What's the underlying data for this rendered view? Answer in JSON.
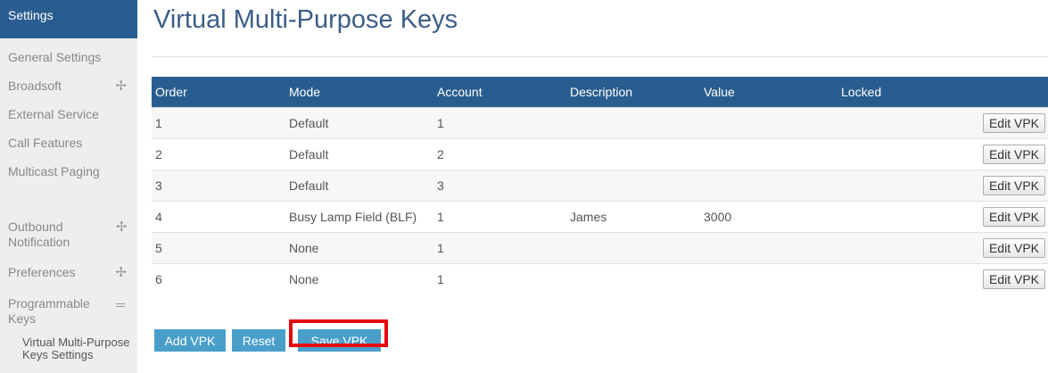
{
  "sidebar": {
    "header": "Settings",
    "items": [
      {
        "label": "General Settings"
      },
      {
        "label": "Broadsoft",
        "expander": "plus"
      },
      {
        "label": "External Service"
      },
      {
        "label": "Call Features"
      },
      {
        "label": "Multicast Paging"
      },
      {
        "label": "Outbound Notification",
        "expander": "plus"
      },
      {
        "label": "Preferences",
        "expander": "plus"
      },
      {
        "label": "Programmable Keys",
        "expander": "minus"
      }
    ],
    "subitem": "Virtual Multi-Purpose Keys Settings"
  },
  "main": {
    "title": "Virtual Multi-Purpose Keys",
    "columns": [
      "Order",
      "Mode",
      "Account",
      "Description",
      "Value",
      "Locked"
    ],
    "rows": [
      {
        "order": "1",
        "mode": "Default",
        "account": "1",
        "description": "",
        "value": "",
        "locked": "",
        "action": "Edit VPK"
      },
      {
        "order": "2",
        "mode": "Default",
        "account": "2",
        "description": "",
        "value": "",
        "locked": "",
        "action": "Edit VPK"
      },
      {
        "order": "3",
        "mode": "Default",
        "account": "3",
        "description": "",
        "value": "",
        "locked": "",
        "action": "Edit VPK"
      },
      {
        "order": "4",
        "mode": "Busy Lamp Field (BLF)",
        "account": "1",
        "description": "James",
        "value": "3000",
        "locked": "",
        "action": "Edit VPK"
      },
      {
        "order": "5",
        "mode": "None",
        "account": "1",
        "description": "",
        "value": "",
        "locked": "",
        "action": "Edit VPK"
      },
      {
        "order": "6",
        "mode": "None",
        "account": "1",
        "description": "",
        "value": "",
        "locked": "",
        "action": "Edit VPK"
      }
    ],
    "buttons": {
      "add": "Add VPK",
      "reset": "Reset",
      "save": "Save VPK"
    }
  },
  "colors": {
    "header_blue": "#295d8f",
    "button_blue": "#4a9fca",
    "title_blue": "#3c5d86",
    "highlight_red": "#e8040c",
    "sidebar_bg": "#eeeeee"
  }
}
